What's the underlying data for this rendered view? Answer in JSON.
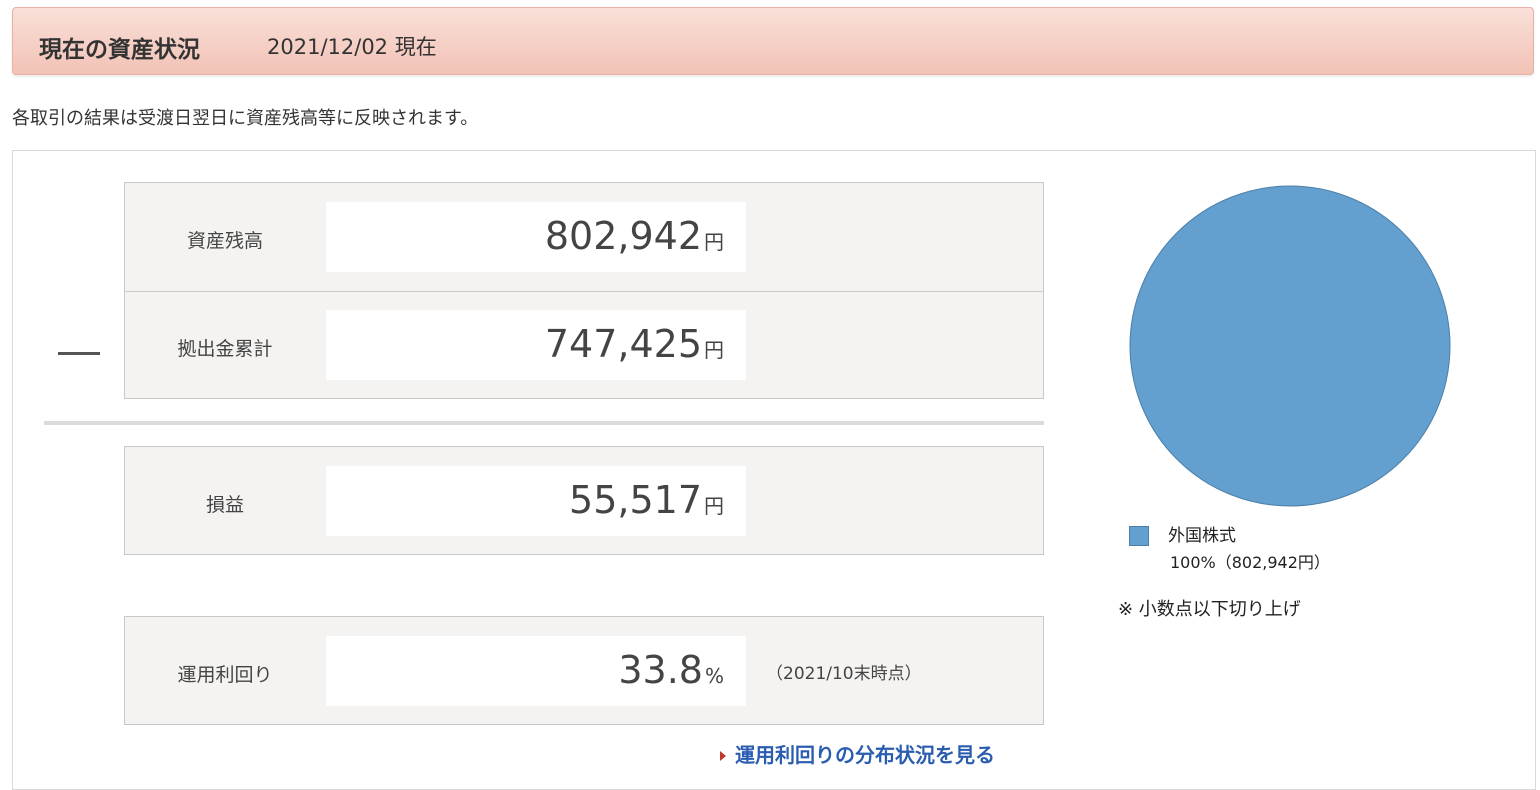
{
  "header": {
    "title": "現在の資産状況",
    "date": "2021/12/02 現在"
  },
  "notice": "各取引の結果は受渡日翌日に資産残高等に反映されます。",
  "summary": {
    "operator_symbol": "—",
    "asset_balance": {
      "label": "資産残高",
      "value": "802,942",
      "unit": "円"
    },
    "total_contribution": {
      "label": "拠出金累計",
      "value": "747,425",
      "unit": "円"
    },
    "profit_loss": {
      "label": "損益",
      "value": "55,517",
      "unit": "円"
    },
    "yield": {
      "label": "運用利回り",
      "value": "33.8",
      "unit": "%",
      "note": "（2021/10末時点）"
    }
  },
  "link": {
    "label": "運用利回りの分布状況を見る"
  },
  "allocation": {
    "items": [
      {
        "name": "外国株式",
        "percent": 100,
        "detail": "100%（802,942円）",
        "color": "#63a0cf"
      }
    ],
    "footnote": "※ 小数点以下切り上げ"
  },
  "chart_data": {
    "type": "pie",
    "categories": [
      "外国株式"
    ],
    "values": [
      100
    ],
    "labels": [
      "100%（802,942円）"
    ],
    "colors": [
      "#63a0cf"
    ],
    "legend": "bottom-left"
  },
  "colors": {
    "header_bg": "#f2c2b6",
    "panel_bg": "#f4f3f1",
    "link": "#2a5db0",
    "pie_blue": "#63a0cf"
  }
}
